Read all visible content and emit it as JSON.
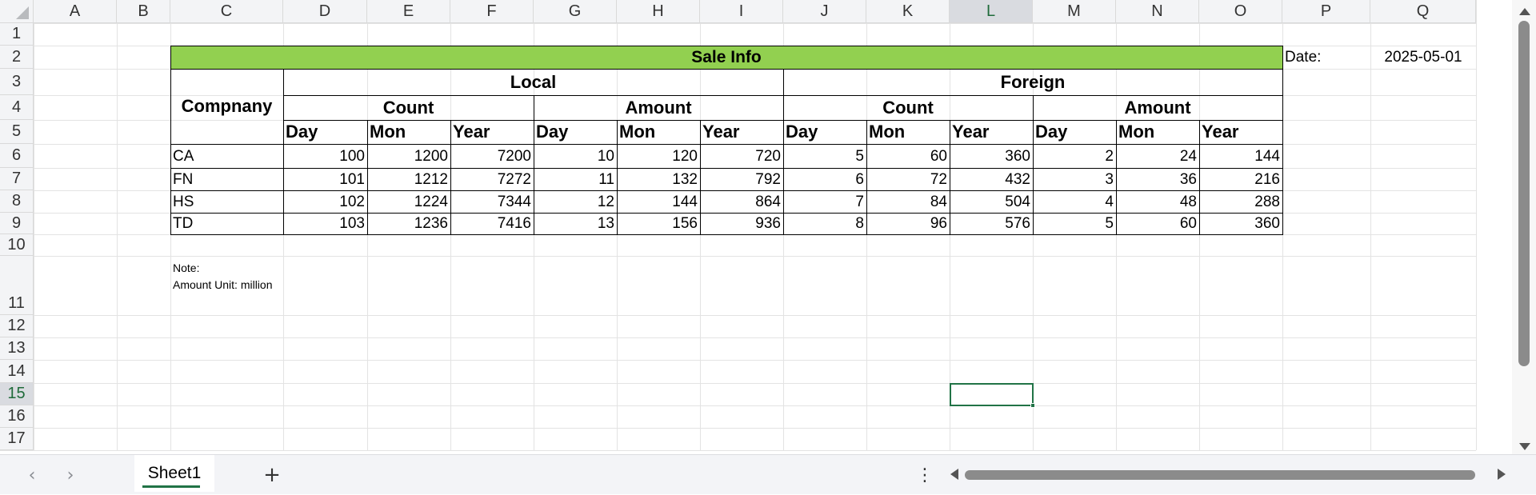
{
  "columns": [
    "A",
    "B",
    "C",
    "D",
    "E",
    "F",
    "G",
    "H",
    "I",
    "J",
    "K",
    "L",
    "M",
    "N",
    "O",
    "P",
    "Q"
  ],
  "rows": [
    "1",
    "2",
    "3",
    "4",
    "5",
    "6",
    "7",
    "8",
    "9",
    "10",
    "11",
    "12",
    "13",
    "14",
    "15",
    "16",
    "17"
  ],
  "selected": {
    "column": "L",
    "row": "15",
    "cell": "L15"
  },
  "sheet": {
    "title": "Sale Info",
    "date_label": "Date:",
    "date_value": "2025-05-01",
    "company_header": "Compnany",
    "groups": [
      "Local",
      "Foreign"
    ],
    "subgroups": [
      "Count",
      "Amount",
      "Count",
      "Amount"
    ],
    "periods": [
      "Day",
      "Mon",
      "Year",
      "Day",
      "Mon",
      "Year",
      "Day",
      "Mon",
      "Year",
      "Day",
      "Mon",
      "Year"
    ],
    "data_rows": [
      {
        "company": "CA",
        "values": [
          "100",
          "1200",
          "7200",
          "10",
          "120",
          "720",
          "5",
          "60",
          "360",
          "2",
          "24",
          "144"
        ]
      },
      {
        "company": "FN",
        "values": [
          "101",
          "1212",
          "7272",
          "11",
          "132",
          "792",
          "6",
          "72",
          "432",
          "3",
          "36",
          "216"
        ]
      },
      {
        "company": "HS",
        "values": [
          "102",
          "1224",
          "7344",
          "12",
          "144",
          "864",
          "7",
          "84",
          "504",
          "4",
          "48",
          "288"
        ]
      },
      {
        "company": "TD",
        "values": [
          "103",
          "1236",
          "7416",
          "13",
          "156",
          "936",
          "8",
          "96",
          "576",
          "5",
          "60",
          "360"
        ]
      }
    ],
    "note_line1": "Note:",
    "note_line2": "Amount Unit: million"
  },
  "colors": {
    "title_fill": "#92d050",
    "accent": "#217346"
  },
  "tabs": [
    {
      "label": "Sheet1",
      "active": true
    }
  ],
  "icons": {
    "prev_sheet": "chevron-left-icon",
    "next_sheet": "chevron-right-icon",
    "add_sheet": "plus-icon",
    "more_options": "vertical-dots-icon"
  },
  "glyphs": {
    "prev": "‹",
    "next": "›",
    "add": "+",
    "more": "⋮"
  }
}
